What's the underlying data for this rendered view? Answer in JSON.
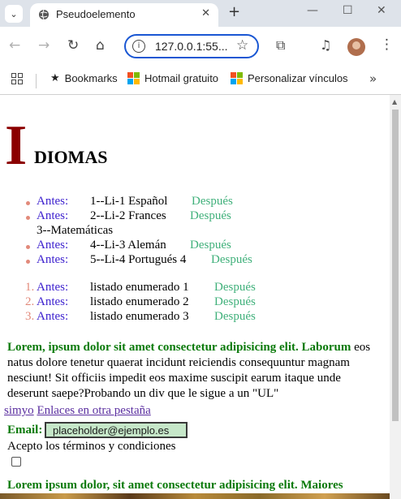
{
  "browser": {
    "tab_title": "Pseudoelemento",
    "url": "127.0.0.1:55...",
    "bookmarks": [
      {
        "label": "Bookmarks",
        "icon": "star-icon"
      },
      {
        "label": "Hotmail gratuito",
        "icon": "microsoft-icon"
      },
      {
        "label": "Personalizar vínculos",
        "icon": "microsoft-icon"
      }
    ]
  },
  "heading": {
    "initial": "I",
    "rest": "DIOMAS"
  },
  "unordered_list": [
    {
      "before": "Antes:",
      "text": "1--Li-1 Español",
      "after": "Después"
    },
    {
      "before": "Antes:",
      "text": "2--Li-2 Frances",
      "after": "Después"
    },
    {
      "text": "3--Matemáticas"
    },
    {
      "before": "Antes:",
      "text": "4--Li-3 Alemán",
      "after": "Después"
    },
    {
      "before": "Antes:",
      "text": "5--Li-4 Portugués 4",
      "after": "Después"
    }
  ],
  "ordered_list": [
    {
      "number": "1.",
      "before": "Antes:",
      "text": "listado enumerado 1",
      "after": "Después"
    },
    {
      "number": "2.",
      "before": "Antes:",
      "text": "listado enumerado 2",
      "after": "Después"
    },
    {
      "number": "3.",
      "before": "Antes:",
      "text": "listado enumerado 3",
      "after": "Después"
    }
  ],
  "paragraph": {
    "bold": "Lorem, ipsum dolor sit amet consectetur adipisicing elit. Laborum",
    "text": "eos natus dolore tenetur quaerat incidunt reiciendis consequuntur magnam nesciunt! Sit officiis impedit eos maxime suscipit earum itaque unde deserunt saepe?Probando un div que le sigue a un \"UL\""
  },
  "links": {
    "first": "simyo",
    "second": "Enlaces en otra pestaña"
  },
  "form": {
    "email_label": "Email:",
    "email_placeholder": "placeholder@ejemplo.es",
    "terms_label": "Acepto los términos y condiciones"
  },
  "paragraph2": {
    "bold": "Lorem ipsum dolor, sit amet consectetur adipisicing elit. Maiores"
  },
  "colors": {
    "heading_initial": "#8b0000",
    "antes": "#3b1fce",
    "despues": "#3fb07a",
    "bold_green": "#0b7a0b",
    "marker": "#e28a7b"
  }
}
